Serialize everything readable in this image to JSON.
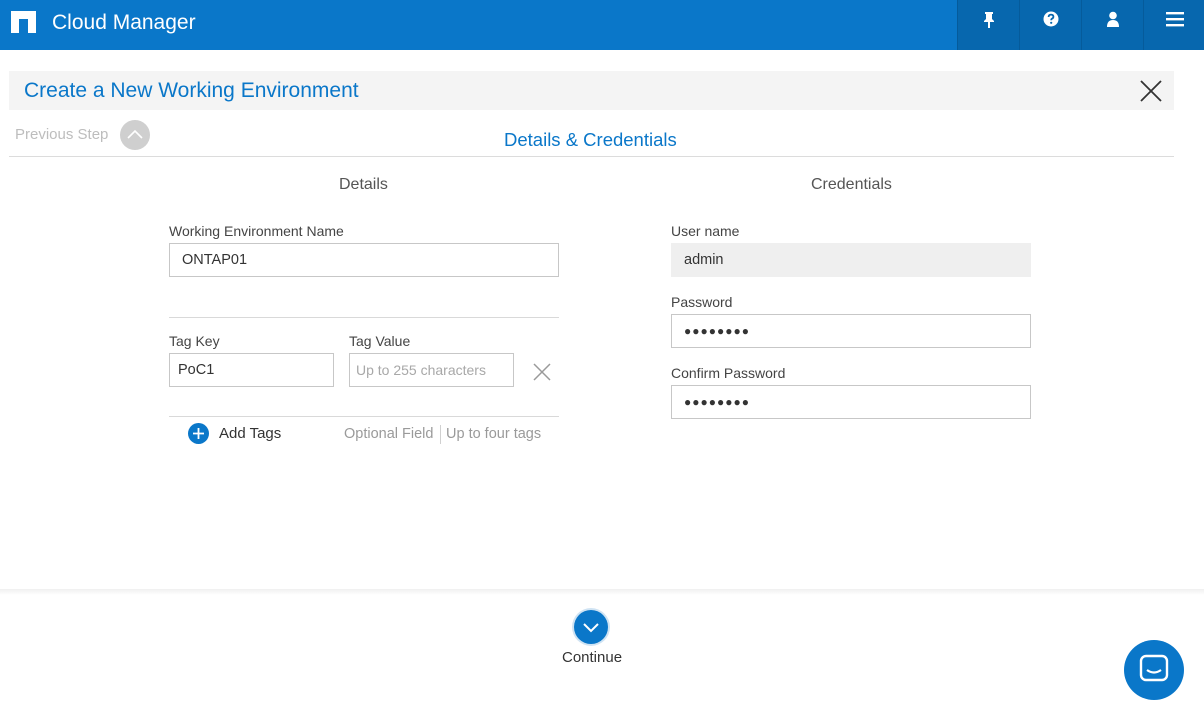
{
  "topbar": {
    "app_title": "Cloud Manager",
    "icons": [
      "pin-icon",
      "help-icon",
      "user-icon",
      "menu-icon"
    ]
  },
  "header": {
    "title": "Create a New Working Environment"
  },
  "step": {
    "previous_label": "Previous Step",
    "title": "Details & Credentials"
  },
  "details": {
    "heading": "Details",
    "we_name_label": "Working Environment Name",
    "we_name_value": "ONTAP01",
    "tag_key_label": "Tag Key",
    "tag_key_value": "PoC1",
    "tag_value_label": "Tag Value",
    "tag_value_placeholder": "Up to 255 characters",
    "add_tags_label": "Add Tags",
    "hint_optional": "Optional Field",
    "hint_limit": "Up to four tags"
  },
  "credentials": {
    "heading": "Credentials",
    "username_label": "User name",
    "username_value": "admin",
    "password_label": "Password",
    "password_value": "●●●●●●●●",
    "confirm_label": "Confirm Password",
    "confirm_value": "●●●●●●●●"
  },
  "footer": {
    "continue_label": "Continue"
  },
  "colors": {
    "accent": "#0a77c9",
    "topbar": "#0a77c9",
    "topbar_button": "#0767ae"
  }
}
